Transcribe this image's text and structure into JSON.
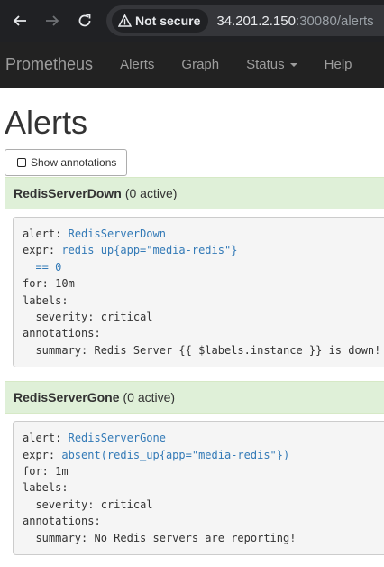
{
  "browser": {
    "security_label": "Not secure",
    "url_host": "34.201.2.150",
    "url_rest": ":30080/alerts"
  },
  "navbar": {
    "brand": "Prometheus",
    "links": [
      "Alerts",
      "Graph",
      "Status",
      "Help"
    ]
  },
  "page": {
    "title": "Alerts",
    "annotations_button": "Show annotations"
  },
  "alerts": [
    {
      "name": "RedisServerDown",
      "count": "(0 active)",
      "rule": {
        "alert_key": "alert:",
        "alert_value": "RedisServerDown",
        "expr_key": "expr:",
        "expr_line1": "redis_up{app=\"media-redis\"}",
        "expr_line2": "== 0",
        "for_key": "for:",
        "for_value": "10m",
        "labels_key": "labels:",
        "severity_key": "severity:",
        "severity_value": "critical",
        "annotations_key": "annotations:",
        "summary_key": "summary:",
        "summary_value": "Redis Server {{ $labels.instance }} is down!"
      }
    },
    {
      "name": "RedisServerGone",
      "count": "(0 active)",
      "rule": {
        "alert_key": "alert:",
        "alert_value": "RedisServerGone",
        "expr_key": "expr:",
        "expr_line1": "absent(redis_up{app=\"media-redis\"})",
        "for_key": "for:",
        "for_value": "1m",
        "labels_key": "labels:",
        "severity_key": "severity:",
        "severity_value": "critical",
        "annotations_key": "annotations:",
        "summary_key": "summary:",
        "summary_value": "No Redis servers are reporting!"
      }
    }
  ]
}
